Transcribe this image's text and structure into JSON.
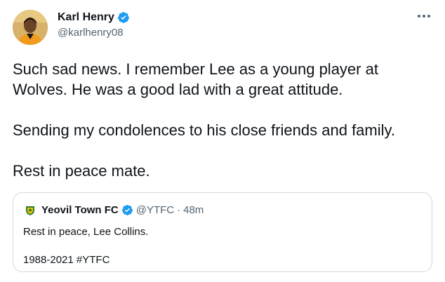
{
  "tweet": {
    "author": {
      "display_name": "Karl Henry",
      "handle": "@karlhenry08",
      "verified": true,
      "avatar": "profile-photo"
    },
    "more_icon": "ellipsis-icon",
    "paragraphs": [
      "Such sad news. I remember Lee as a young player at Wolves. He was a good lad with a great attitude.",
      "Sending my condolences to his close friends and family.",
      "Rest in peace mate."
    ]
  },
  "quoted_tweet": {
    "author": {
      "display_name": "Yeovil Town FC",
      "handle": "@YTFC",
      "verified": true,
      "logo": "club-crest"
    },
    "separator": "·",
    "time": "48m",
    "lines": [
      "Rest in peace, Lee Collins.",
      "1988-2021 #YTFC"
    ]
  },
  "colors": {
    "text": "#0f1419",
    "secondary": "#536471",
    "verified_blue": "#1d9bf0",
    "border": "#cfd9de",
    "crest_green": "#2e7d32",
    "crest_yellow": "#f2c300"
  }
}
